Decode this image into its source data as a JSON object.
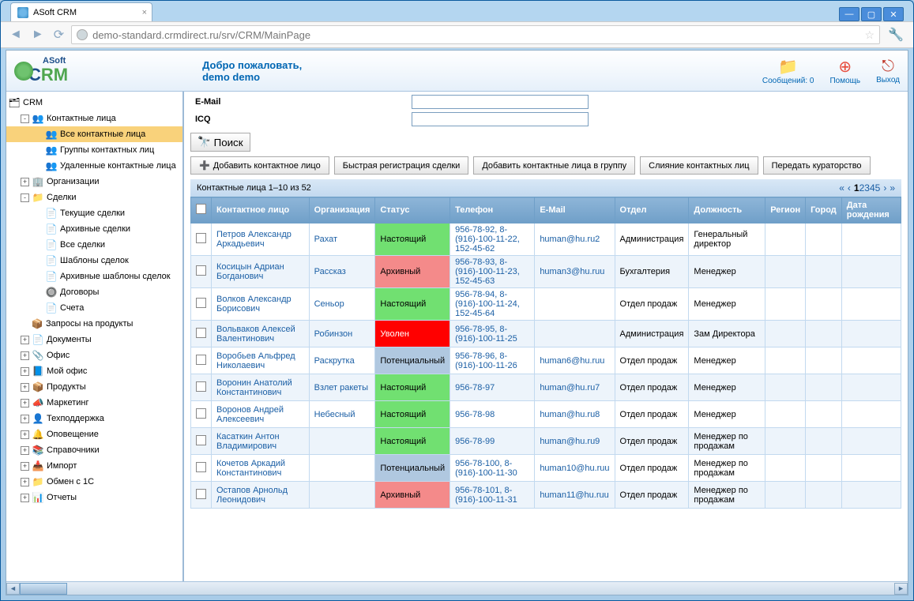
{
  "window": {
    "tab_title": "ASoft CRM",
    "url": "demo-standard.crmdirect.ru/srv/CRM/MainPage"
  },
  "header": {
    "logo_small": "ASoft",
    "logo_big": "CRM",
    "welcome_line1": "Добро пожаловать,",
    "welcome_line2": "demo demo",
    "msgs": "Сообщений: 0",
    "help": "Помощь",
    "exit": "Выход"
  },
  "sidebar": {
    "root": "CRM",
    "items": [
      {
        "lvl": 2,
        "exp": "-",
        "icon": "👥",
        "label": "Контактные лица"
      },
      {
        "lvl": 3,
        "exp": "",
        "icon": "👥",
        "label": "Все контактные лица",
        "sel": true
      },
      {
        "lvl": 3,
        "exp": "",
        "icon": "👥",
        "label": "Группы контактных лиц"
      },
      {
        "lvl": 3,
        "exp": "",
        "icon": "👥",
        "label": "Удаленные контактные лица"
      },
      {
        "lvl": 2,
        "exp": "+",
        "icon": "🏢",
        "label": "Организации"
      },
      {
        "lvl": 2,
        "exp": "-",
        "icon": "📁",
        "label": "Сделки"
      },
      {
        "lvl": 3,
        "exp": "",
        "icon": "📄",
        "label": "Текущие сделки"
      },
      {
        "lvl": 3,
        "exp": "",
        "icon": "📄",
        "label": "Архивные сделки"
      },
      {
        "lvl": 3,
        "exp": "",
        "icon": "📄",
        "label": "Все сделки"
      },
      {
        "lvl": 3,
        "exp": "",
        "icon": "📄",
        "label": "Шаблоны сделок"
      },
      {
        "lvl": 3,
        "exp": "",
        "icon": "📄",
        "label": "Архивные шаблоны сделок"
      },
      {
        "lvl": 3,
        "exp": "",
        "icon": "🔘",
        "label": "Договоры"
      },
      {
        "lvl": 3,
        "exp": "",
        "icon": "📄",
        "label": "Счета"
      },
      {
        "lvl": 2,
        "exp": "",
        "icon": "📦",
        "label": "Запросы на продукты"
      },
      {
        "lvl": 2,
        "exp": "+",
        "icon": "📄",
        "label": "Документы"
      },
      {
        "lvl": 2,
        "exp": "+",
        "icon": "📎",
        "label": "Офис"
      },
      {
        "lvl": 2,
        "exp": "+",
        "icon": "📘",
        "label": "Мой офис"
      },
      {
        "lvl": 2,
        "exp": "+",
        "icon": "📦",
        "label": "Продукты"
      },
      {
        "lvl": 2,
        "exp": "+",
        "icon": "📣",
        "label": "Маркетинг"
      },
      {
        "lvl": 2,
        "exp": "+",
        "icon": "👤",
        "label": "Техподдержка"
      },
      {
        "lvl": 2,
        "exp": "+",
        "icon": "🔔",
        "label": "Оповещение"
      },
      {
        "lvl": 2,
        "exp": "+",
        "icon": "📚",
        "label": "Справочники"
      },
      {
        "lvl": 2,
        "exp": "+",
        "icon": "📥",
        "label": "Импорт"
      },
      {
        "lvl": 2,
        "exp": "+",
        "icon": "📁",
        "label": "Обмен с 1С"
      },
      {
        "lvl": 2,
        "exp": "+",
        "icon": "📊",
        "label": "Отчеты"
      }
    ]
  },
  "form": {
    "email_label": "E-Mail",
    "icq_label": "ICQ"
  },
  "search_btn": "Поиск",
  "actions": {
    "add": "Добавить контактное лицо",
    "quick": "Быстрая регистрация сделки",
    "add_group": "Добавить контактные лица в группу",
    "merge": "Слияние контактных лиц",
    "transfer": "Передать кураторство"
  },
  "pager": {
    "summary": "Контактные лица 1–10 из 52",
    "pages": [
      "1",
      "2",
      "3",
      "4",
      "5"
    ],
    "current": "1"
  },
  "columns": [
    "Контактное лицо",
    "Организация",
    "Статус",
    "Телефон",
    "E-Mail",
    "Отдел",
    "Должность",
    "Регион",
    "Город",
    "Дата рождения"
  ],
  "statuses": {
    "now": "Настоящий",
    "arch": "Архивный",
    "fired": "Уволен",
    "pot": "Потенциальный"
  },
  "rows": [
    {
      "name": "Петров Александр Аркадьевич",
      "org": "Рахат",
      "status": "now",
      "phone": "956-78-92, 8-(916)-100-11-22, 152-45-62",
      "email": "human@hu.ru2",
      "dept": "Администрация",
      "pos": "Генеральный директор"
    },
    {
      "name": "Косицын Адриан Богданович",
      "org": "Рассказ",
      "status": "arch",
      "phone": "956-78-93, 8-(916)-100-11-23, 152-45-63",
      "email": "human3@hu.ruu",
      "dept": "Бухгалтерия",
      "pos": "Менеджер"
    },
    {
      "name": "Волков Александр Борисович",
      "org": "Сеньор",
      "status": "now",
      "phone": "956-78-94, 8-(916)-100-11-24, 152-45-64",
      "email": "",
      "dept": "Отдел продаж",
      "pos": "Менеджер"
    },
    {
      "name": "Вольваков Алексей Валентинович",
      "org": "Робинзон",
      "status": "fired",
      "phone": "956-78-95, 8-(916)-100-11-25",
      "email": "",
      "dept": "Администрация",
      "pos": "Зам Директора"
    },
    {
      "name": "Воробьев Альфред Николаевич",
      "org": "Раскрутка",
      "status": "pot",
      "phone": "956-78-96, 8-(916)-100-11-26",
      "email": "human6@hu.ruu",
      "dept": "Отдел продаж",
      "pos": "Менеджер"
    },
    {
      "name": "Воронин Анатолий Константинович",
      "org": "Взлет ракеты",
      "status": "now",
      "phone": "956-78-97",
      "email": "human@hu.ru7",
      "dept": "Отдел продаж",
      "pos": "Менеджер"
    },
    {
      "name": "Воронов Андрей Алексеевич",
      "org": "Небесный",
      "status": "now",
      "phone": "956-78-98",
      "email": "human@hu.ru8",
      "dept": "Отдел продаж",
      "pos": "Менеджер"
    },
    {
      "name": "Касаткин Антон Владимирович",
      "org": "",
      "status": "now",
      "phone": "956-78-99",
      "email": "human@hu.ru9",
      "dept": "Отдел продаж",
      "pos": "Менеджер по продажам"
    },
    {
      "name": "Кочетов Аркадий Константинович",
      "org": "",
      "status": "pot",
      "phone": "956-78-100, 8-(916)-100-11-30",
      "email": "human10@hu.ruu",
      "dept": "Отдел продаж",
      "pos": "Менеджер по продажам"
    },
    {
      "name": "Остапов Арнольд Леонидович",
      "org": "",
      "status": "arch",
      "phone": "956-78-101, 8-(916)-100-11-31",
      "email": "human11@hu.ruu",
      "dept": "Отдел продаж",
      "pos": "Менеджер по продажам"
    }
  ]
}
